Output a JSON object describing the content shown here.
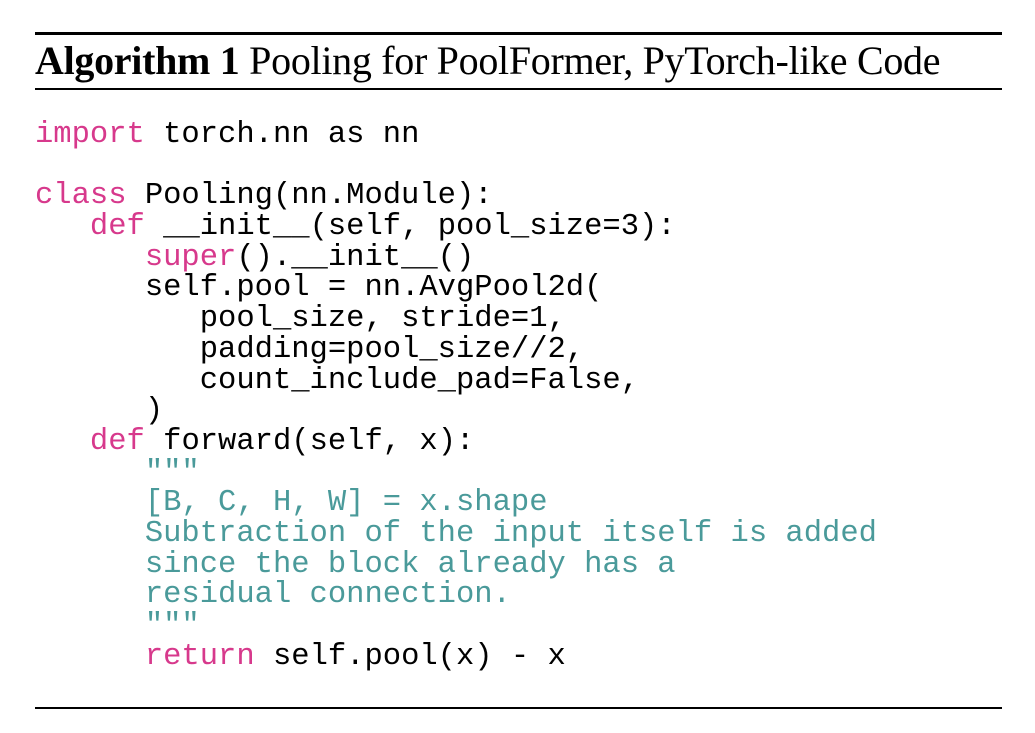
{
  "algorithm": {
    "label": "Algorithm 1",
    "title": "Pooling for PoolFormer, PyTorch-like Code"
  },
  "colors": {
    "keyword": "#d7398c",
    "docstring": "#4a9a9a",
    "text": "#000000"
  },
  "code_lines": [
    {
      "indent": "",
      "parts": [
        {
          "t": "import",
          "c": "kw"
        },
        {
          "t": " torch.nn as nn",
          "c": ""
        }
      ]
    },
    {
      "indent": "",
      "parts": []
    },
    {
      "indent": "",
      "parts": [
        {
          "t": "class",
          "c": "kw"
        },
        {
          "t": " Pooling(nn.Module):",
          "c": ""
        }
      ]
    },
    {
      "indent": "   ",
      "parts": [
        {
          "t": "def",
          "c": "kw"
        },
        {
          "t": " __init__(self, pool_size=3):",
          "c": ""
        }
      ]
    },
    {
      "indent": "      ",
      "parts": [
        {
          "t": "super",
          "c": "kw"
        },
        {
          "t": "().__init__()",
          "c": ""
        }
      ]
    },
    {
      "indent": "      ",
      "parts": [
        {
          "t": "self.pool = nn.AvgPool2d(",
          "c": ""
        }
      ]
    },
    {
      "indent": "         ",
      "parts": [
        {
          "t": "pool_size, stride=1,",
          "c": ""
        }
      ]
    },
    {
      "indent": "         ",
      "parts": [
        {
          "t": "padding=pool_size//2,",
          "c": ""
        }
      ]
    },
    {
      "indent": "         ",
      "parts": [
        {
          "t": "count_include_pad=False,",
          "c": ""
        }
      ]
    },
    {
      "indent": "      ",
      "parts": [
        {
          "t": ")",
          "c": ""
        }
      ]
    },
    {
      "indent": "   ",
      "parts": [
        {
          "t": "def",
          "c": "kw"
        },
        {
          "t": " forward(self, x):",
          "c": ""
        }
      ]
    },
    {
      "indent": "      ",
      "parts": [
        {
          "t": "\"\"\"",
          "c": "doc"
        }
      ]
    },
    {
      "indent": "      ",
      "parts": [
        {
          "t": "[B, C, H, W] = x.shape",
          "c": "doc"
        }
      ]
    },
    {
      "indent": "      ",
      "parts": [
        {
          "t": "Subtraction of the input itself is added",
          "c": "doc"
        }
      ]
    },
    {
      "indent": "      ",
      "parts": [
        {
          "t": "since the block already has a",
          "c": "doc"
        }
      ]
    },
    {
      "indent": "      ",
      "parts": [
        {
          "t": "residual connection.",
          "c": "doc"
        }
      ]
    },
    {
      "indent": "      ",
      "parts": [
        {
          "t": "\"\"\"",
          "c": "doc"
        }
      ]
    },
    {
      "indent": "      ",
      "parts": [
        {
          "t": "return",
          "c": "kw"
        },
        {
          "t": " self.pool(x) - x",
          "c": ""
        }
      ]
    }
  ]
}
